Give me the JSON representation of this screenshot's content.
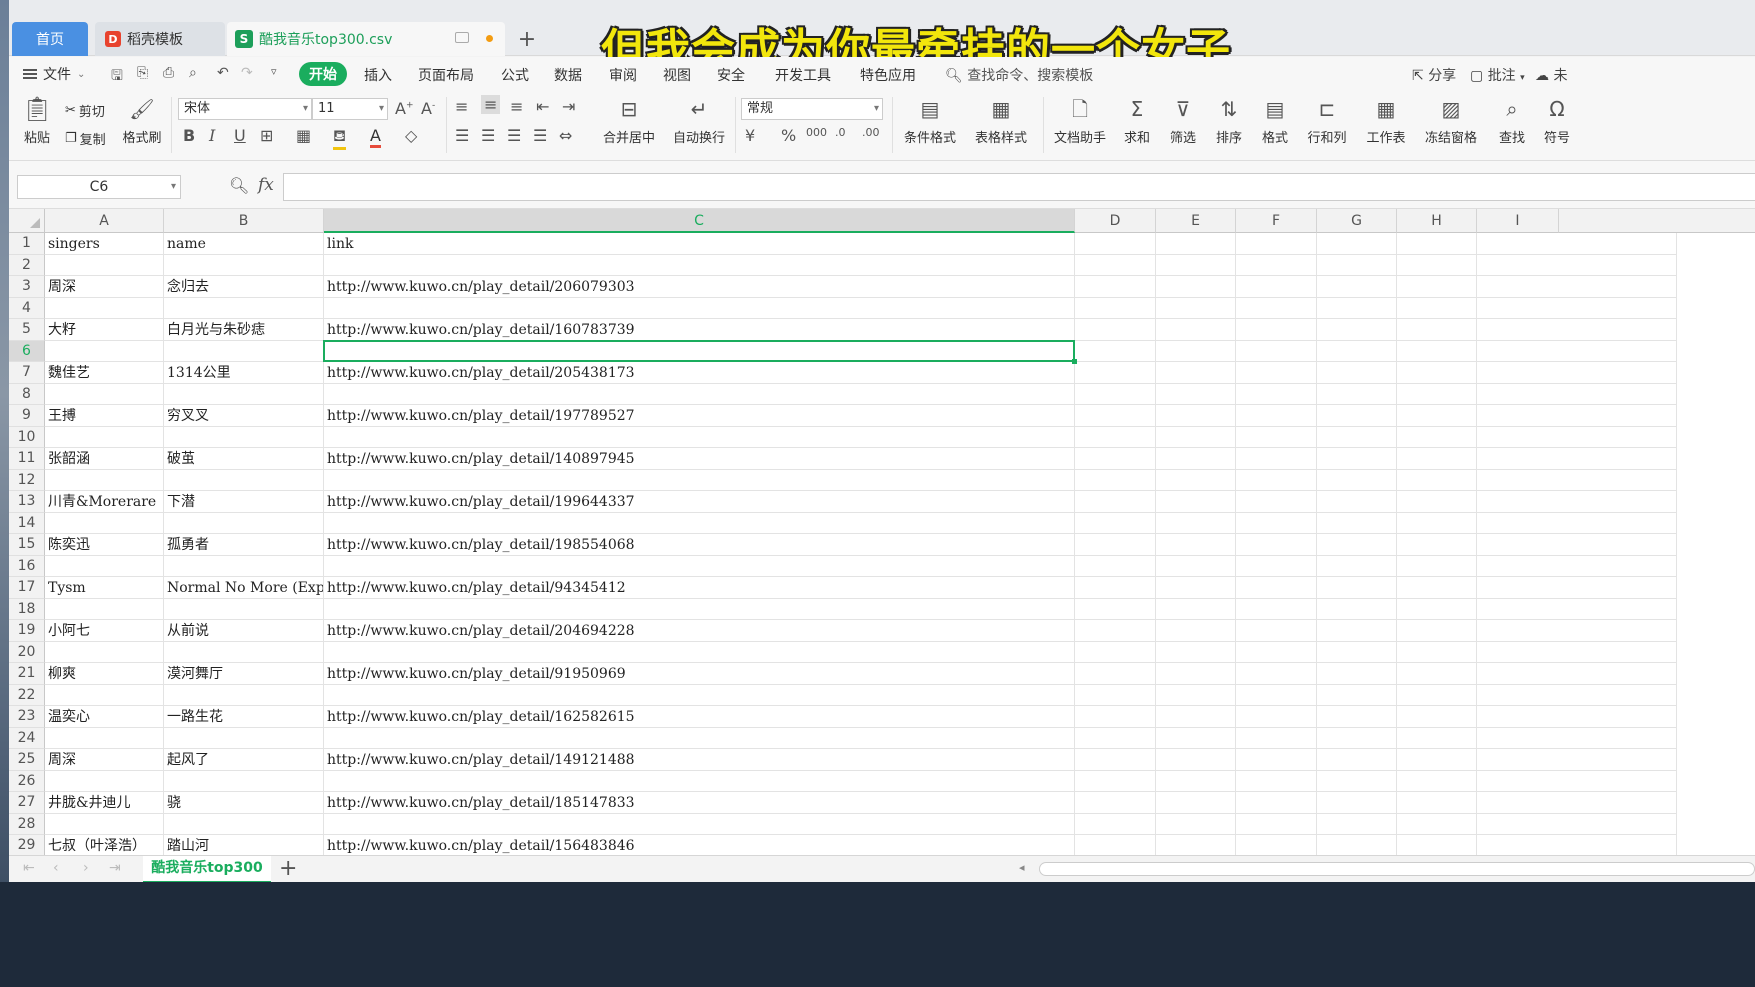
{
  "tabs": {
    "home": "首页",
    "templates": "稻壳模板",
    "file": "酷我音乐top300.csv",
    "template_icon": "D",
    "file_icon": "S",
    "add": "+"
  },
  "caption": "但我会成为你最牵挂的一个女子",
  "menu": {
    "file": "文件",
    "start": "开始",
    "items": [
      "插入",
      "页面布局",
      "公式",
      "数据",
      "审阅",
      "视图",
      "安全",
      "开发工具",
      "特色应用"
    ],
    "search": "查找命令、搜索模板",
    "share": "分享",
    "comment": "批注",
    "cloud": "未"
  },
  "ribbon": {
    "paste": "粘贴",
    "cut": "剪切",
    "copy": "复制",
    "format_painter": "格式刷",
    "font_name": "宋体",
    "font_size": "11",
    "number_format": "常规",
    "merge_center": "合并居中",
    "auto_wrap": "自动换行",
    "cond_format": "条件格式",
    "table_style": "表格样式",
    "doc_assistant": "文档助手",
    "sum": "求和",
    "filter": "筛选",
    "sort": "排序",
    "format": "格式",
    "row_col": "行和列",
    "worksheet": "工作表",
    "freeze": "冻结窗格",
    "find": "查找",
    "symbol": "符号"
  },
  "formula_bar": {
    "cell_ref": "C6",
    "fx": "fx",
    "value": ""
  },
  "columns": [
    "A",
    "B",
    "C",
    "D",
    "E",
    "F",
    "G",
    "H",
    "I"
  ],
  "rows": [
    [
      "singers",
      "name",
      "link"
    ],
    [
      "",
      "",
      ""
    ],
    [
      "周深",
      "念归去",
      "http://www.kuwo.cn/play_detail/206079303"
    ],
    [
      "",
      "",
      ""
    ],
    [
      "大籽",
      "白月光与朱砂痣",
      "http://www.kuwo.cn/play_detail/160783739"
    ],
    [
      "",
      "",
      ""
    ],
    [
      "魏佳艺",
      "1314公里",
      "http://www.kuwo.cn/play_detail/205438173"
    ],
    [
      "",
      "",
      ""
    ],
    [
      "王搏",
      "穷叉叉",
      "http://www.kuwo.cn/play_detail/197789527"
    ],
    [
      "",
      "",
      ""
    ],
    [
      "张韶涵",
      "破茧",
      "http://www.kuwo.cn/play_detail/140897945"
    ],
    [
      "",
      "",
      ""
    ],
    [
      "川青&Morerare",
      "下潜",
      "http://www.kuwo.cn/play_detail/199644337"
    ],
    [
      "",
      "",
      ""
    ],
    [
      "陈奕迅",
      "孤勇者",
      "http://www.kuwo.cn/play_detail/198554068"
    ],
    [
      "",
      "",
      ""
    ],
    [
      "Tysm",
      "Normal No More (Explicit)",
      "http://www.kuwo.cn/play_detail/94345412"
    ],
    [
      "",
      "",
      ""
    ],
    [
      "小阿七",
      "从前说",
      "http://www.kuwo.cn/play_detail/204694228"
    ],
    [
      "",
      "",
      ""
    ],
    [
      "柳爽",
      "漠河舞厅",
      "http://www.kuwo.cn/play_detail/91950969"
    ],
    [
      "",
      "",
      ""
    ],
    [
      "温奕心",
      "一路生花",
      "http://www.kuwo.cn/play_detail/162582615"
    ],
    [
      "",
      "",
      ""
    ],
    [
      "周深",
      "起风了",
      "http://www.kuwo.cn/play_detail/149121488"
    ],
    [
      "",
      "",
      ""
    ],
    [
      "井胧&井迪儿",
      "骁",
      "http://www.kuwo.cn/play_detail/185147833"
    ],
    [
      "",
      "",
      ""
    ],
    [
      "七叔（叶泽浩）",
      "踏山河",
      "http://www.kuwo.cn/play_detail/156483846"
    ]
  ],
  "active_cell": {
    "col": "C",
    "row": 6
  },
  "sheet": {
    "name": "酷我音乐top300",
    "add": "+"
  },
  "colors": {
    "accent": "#1aad5e",
    "home_tab": "#4a90e2",
    "caption": "#f2e60c"
  }
}
